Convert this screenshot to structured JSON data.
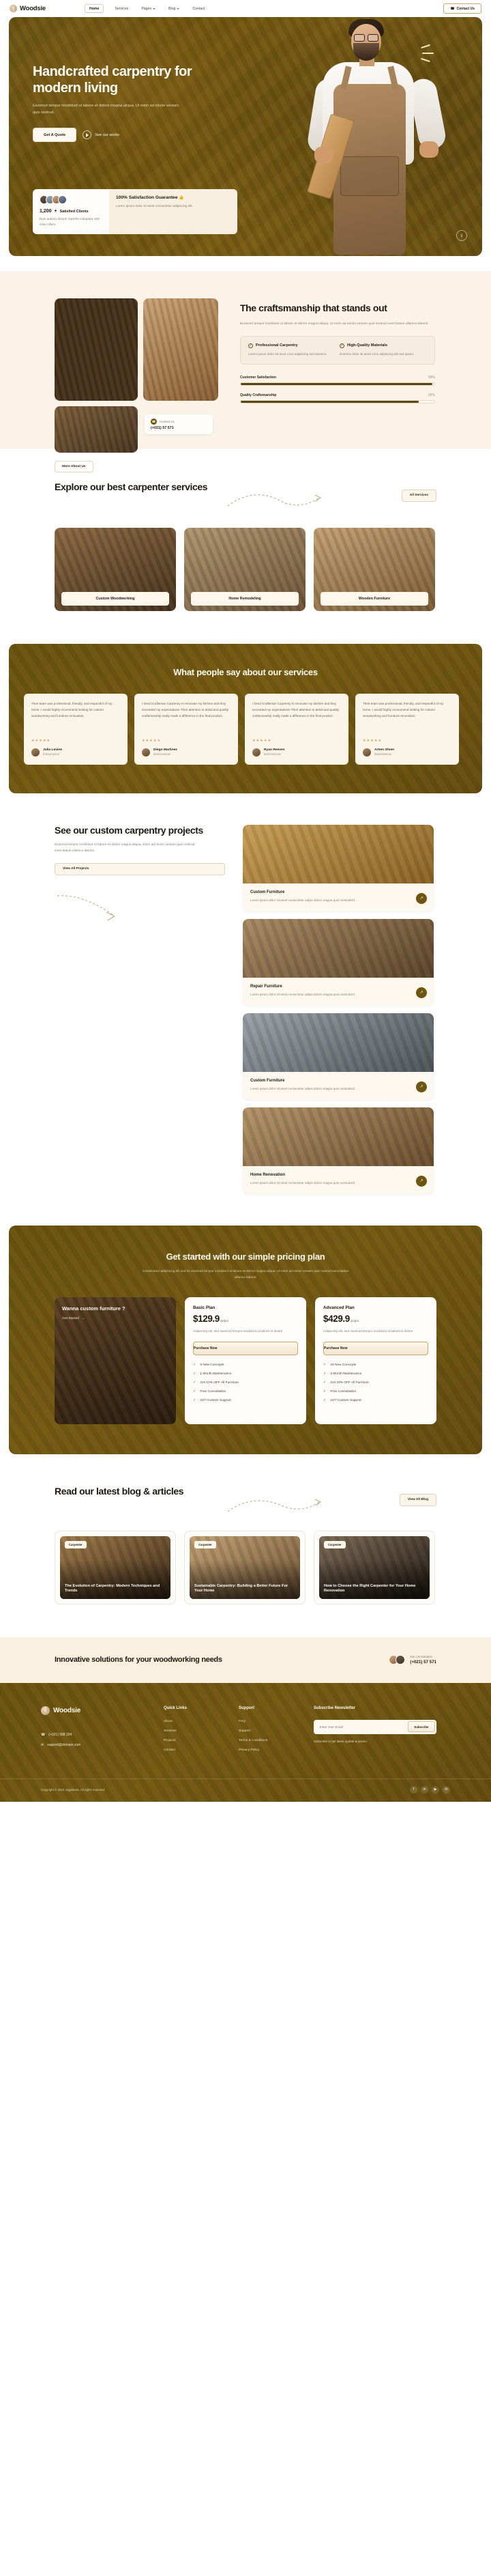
{
  "nav": {
    "brand": "Woodsie",
    "links": [
      {
        "label": "Home",
        "active": true,
        "caret": false
      },
      {
        "label": "Services",
        "active": false,
        "caret": false
      },
      {
        "label": "Pages",
        "active": false,
        "caret": true
      },
      {
        "label": "Blog",
        "active": false,
        "caret": true
      },
      {
        "label": "Contact",
        "active": false,
        "caret": false
      }
    ],
    "contact_button": "Contact Us"
  },
  "hero": {
    "title": "Handcrafted carpentry for modern living",
    "subtitle": "Eiusmod tempor incididunt ut labore et dolore magna aliqua. Ut enim ad minim veniam quis nostrud.",
    "primary_button": "Get A Quote",
    "secondary_button": "See our works",
    "stat_count": "1,200",
    "stat_plus": "+",
    "stat_label": "Satisfied Clients",
    "stat_desc": "Duis auteiru dolorin reprehe voluptate velit esse cillum.",
    "guarantee_title": "100% Satisfaction Guarantee",
    "guarantee_emoji": "👍",
    "guarantee_desc": "Lorem ipsum dolor sit amet consectetur adipiscing elit."
  },
  "craft": {
    "title": "The craftsmanship that stands out",
    "paragraph": "Eiusmod tempor incididunt ut labore et dolore magna aliqua. Ut enim ad minim veniam quis nostrud exercitation ullamco laboris.",
    "features": [
      {
        "title": "Professional Carpentry",
        "desc": "Lorem ipsum dolor sit amet cons adipiscing sed doesmo."
      },
      {
        "title": "High-Quality Materials",
        "desc": "Doesmo dolor sit amet cons adipiscing elit sed ipsum."
      }
    ],
    "bars": [
      {
        "label": "Customer Satisfaction",
        "value": "99%",
        "pct": 99
      },
      {
        "label": "Quality Craftsmanship",
        "value": "92%",
        "pct": 92
      }
    ],
    "contact_label": "Contact Us",
    "contact_number": "(+021) 57 571",
    "more_button": "More About Us"
  },
  "services": {
    "title": "Explore our best carpenter services",
    "all_button": "All Services",
    "cards": [
      {
        "label": "Custom Woodworking"
      },
      {
        "label": "Home Remodeling"
      },
      {
        "label": "Wooden Furniture"
      }
    ]
  },
  "testimonials": {
    "title": "What people say about our services",
    "items": [
      {
        "text": "Their team was professional, friendly, and respectful of my home. I would highly recommend looking for custom woodworking and furniture renovation.",
        "stars": "★★★★★",
        "name": "Julia Levine",
        "role": "Entrepreneur"
      },
      {
        "text": "I hired Craftsman Carpentry to renovate my kitchen and they exceeded my expectations! Their attention to detail and quality craftsmanship really made a difference in the final product.",
        "stars": "★★★★★",
        "name": "Diego Martinez",
        "role": "Businessman"
      },
      {
        "text": "I hired Craftsman Carpentry to renovate my kitchen and they exceeded my expectations! Their attention to detail and quality craftsmanship really made a difference in the final product.",
        "stars": "★★★★★",
        "name": "Ryan Reeves",
        "role": "Businessman"
      },
      {
        "text": "Their team was professional, friendly, and respectful of my home. I would highly recommend looking for custom woodworking and furniture renovation.",
        "stars": "★★★★★",
        "name": "Artem Olsen",
        "role": "Businessman"
      }
    ]
  },
  "projects": {
    "title": "See our custom carpentry projects",
    "subtitle": "Eiusmod tempor incididunt ut labore et dolore magna aliqua. Enim ad minim veniam quis nostrud exercitation ullamco laboris.",
    "all_button": "View All Projects",
    "cards": [
      {
        "title": "Custom Furniture",
        "desc": "Lorem ipsum dolor sit amet consectetur adipis doloro magna quis nostruderd."
      },
      {
        "title": "Repair Furniture",
        "desc": "Lorem ipsum dolor sit amet consectetur adipis doloro magna quis nostruderd."
      },
      {
        "title": "Custom Furniture",
        "desc": "Lorem ipsum dolor sit amet consectetur adipis doloro magna quis nostruderd."
      },
      {
        "title": "Home Renovation",
        "desc": "Lorem ipsum dolor sit amet consectetur adipis doloro magna quis nostruderd."
      }
    ]
  },
  "pricing": {
    "title": "Get started with our simple pricing plan",
    "subtitle": "Consectetur adipiscing elit sed do eiusmod tempor incididunt ut labore et dolore magna aliqua. Ut enim ad minim veniam quis nostrud exercitation ullamco laboris.",
    "promo_title": "Wanna custom furniture ?",
    "promo_link": "Get Started",
    "plans": [
      {
        "name": "Basic Plan",
        "price": "$129.9",
        "period": "/project",
        "desc": "Adipiscing elit, sed eiusmod tempor incididunt ut labore et dolore",
        "button": "Purchase Now",
        "features": [
          "5 New Concepts",
          "1 Month Maintenance",
          "Get 10% OFF All Furniture",
          "Free Consultation",
          "24/7 Custom Support"
        ]
      },
      {
        "name": "Advanced Plan",
        "price": "$429.9",
        "period": "/project",
        "desc": "Adipiscing elit, sed eiusmod tempor incididunt ut labore et dolore",
        "button": "Purchase Now",
        "features": [
          "15 New Concepts",
          "3 Month Maintenance",
          "Get 20% OFF All Furniture",
          "Free Consultation",
          "24/7 Custom Support"
        ]
      }
    ]
  },
  "blog": {
    "title": "Read our latest blog & articles",
    "all_button": "View All Blog",
    "posts": [
      {
        "tag": "Carpenter",
        "title": "The Evolution of Carpentry: Modern Techniques and Trends"
      },
      {
        "tag": "Carpenter",
        "title": "Sustainable Carpentry: Building a Better Future For Your Home"
      },
      {
        "tag": "Carpenter",
        "title": "How to Choose the Right Carpenter for Your Home Renovation"
      }
    ]
  },
  "cta": {
    "title": "Innovative solutions for your woodworking needs",
    "label": "Get Consultation",
    "number": "(+021) 57 571"
  },
  "footer": {
    "brand": "Woodsie",
    "phone": "(+021) 588 334",
    "email": "support@domain.com",
    "columns": [
      {
        "heading": "Quick Links",
        "items": [
          "About",
          "Services",
          "Projects",
          "Contact"
        ]
      },
      {
        "heading": "Support",
        "items": [
          "FAQ",
          "Support",
          "Terms & Conditions",
          "Privacy Policy"
        ]
      }
    ],
    "newsletter_heading": "Subscribe Newsletter",
    "newsletter_placeholder": "Enter Your Email",
    "newsletter_button": "Subscribe",
    "newsletter_note": "Subscribe to get latest update & promo.",
    "copyright": "Copyright © 2024 Jogjakarta. All rights reserved.",
    "socials": [
      "f",
      "in",
      "▶",
      "✉"
    ]
  }
}
